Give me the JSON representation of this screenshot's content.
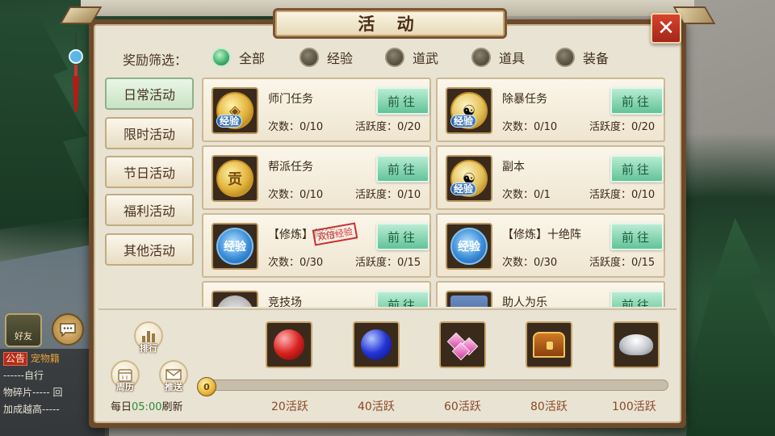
{
  "dialog": {
    "title": "活 动",
    "close_label": "✕"
  },
  "filter": {
    "label": "奖励筛选：",
    "options": [
      {
        "label": "全部",
        "selected": true
      },
      {
        "label": "经验",
        "selected": false
      },
      {
        "label": "道武",
        "selected": false
      },
      {
        "label": "道具",
        "selected": false
      },
      {
        "label": "装备",
        "selected": false
      }
    ]
  },
  "side_tabs": [
    {
      "label": "日常活动",
      "active": true
    },
    {
      "label": "限时活动",
      "active": false
    },
    {
      "label": "节日活动",
      "active": false
    },
    {
      "label": "福利活动",
      "active": false
    },
    {
      "label": "其他活动",
      "active": false
    }
  ],
  "activities": [
    {
      "name": "师门任务",
      "count": "次数：0/10",
      "active": "活跃度：0/20",
      "icon": "gold-coin-icon",
      "badge": "经验",
      "button": "前往"
    },
    {
      "name": "除暴任务",
      "count": "次数：0/10",
      "active": "活跃度：0/20",
      "icon": "taiji-coin-icon",
      "badge": "经验",
      "button": "前往"
    },
    {
      "name": "帮派任务",
      "count": "次数：0/10",
      "active": "活跃度：0/10",
      "icon": "gold-coin-icon",
      "coin_text": "贡",
      "button": "前往"
    },
    {
      "name": "副本",
      "count": "次数：0/1",
      "active": "活跃度：0/10",
      "icon": "taiji-coin-icon",
      "badge": "经验",
      "button": "前往"
    },
    {
      "name": "【修炼】修行",
      "count": "次数：0/30",
      "active": "活跃度：0/15",
      "icon": "exp-orb-icon",
      "coin_text": "经验",
      "stamp": "双倍经验",
      "button": "前往"
    },
    {
      "name": "【修炼】十绝阵",
      "count": "次数：0/30",
      "active": "活跃度：0/15",
      "icon": "exp-orb-icon",
      "coin_text": "经验",
      "button": "前往"
    },
    {
      "name": "竞技场",
      "count": "",
      "active": "",
      "icon": "silver-coin-icon",
      "button": "前往"
    },
    {
      "name": "助人为乐",
      "count": "",
      "active": "",
      "icon": "scroll-icon",
      "button": "前往"
    }
  ],
  "rewards": [
    {
      "label": "20活跃",
      "icon": "red-orb-icon"
    },
    {
      "label": "40活跃",
      "icon": "blue-orb-icon"
    },
    {
      "label": "60活跃",
      "icon": "pink-gems-icon"
    },
    {
      "label": "80活跃",
      "icon": "treasure-chest-icon"
    },
    {
      "label": "100活跃",
      "icon": "silver-ingot-icon"
    }
  ],
  "progress": {
    "value": 0,
    "max": 100,
    "coin_text": "0"
  },
  "footer": {
    "rank_label": "排行",
    "calendar_label": "周历",
    "push_label": "推送",
    "refresh_prefix": "每日",
    "refresh_time": "05:00",
    "refresh_suffix": "刷新"
  },
  "hud": {
    "friend_label": "好友",
    "chat_lines": [
      {
        "tag": "公告",
        "text": "宠物籍"
      },
      {
        "tag": "",
        "text": "------自行"
      },
      {
        "tag": "",
        "text": "物碎片----- 回"
      },
      {
        "tag": "",
        "text": "加成越高-----"
      }
    ]
  },
  "colors": {
    "frame": "#6d4a2c",
    "panel": "#e9e3d4",
    "go_button": "#62c398",
    "close_button": "#d8442c",
    "reward_label": "#8a4a25",
    "refresh_time": "#2f8a3a"
  }
}
